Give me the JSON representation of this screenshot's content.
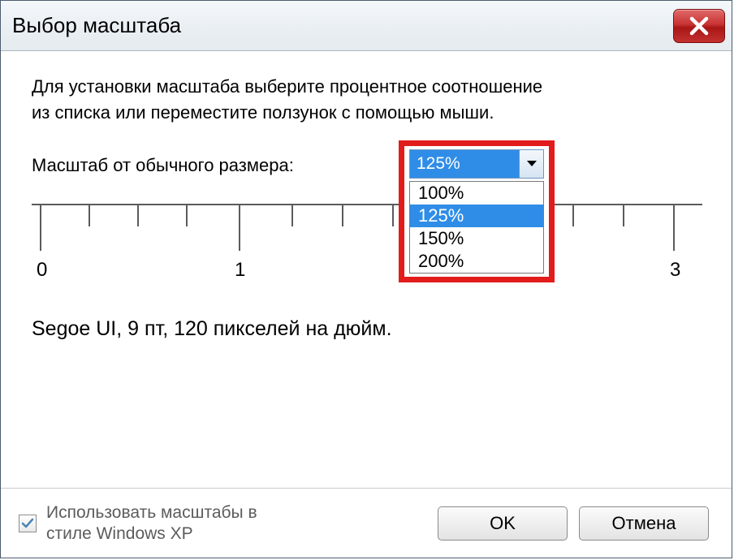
{
  "titlebar": {
    "title": "Выбор масштаба"
  },
  "description": {
    "line1": "Для установки масштаба выберите процентное соотношение",
    "line2": "из списка или переместите ползунок с помощью мыши."
  },
  "scale": {
    "label": "Масштаб от обычного размера:",
    "selected_value": "125%",
    "options": [
      "100%",
      "125%",
      "150%",
      "200%"
    ],
    "selected_index": 1
  },
  "ruler": {
    "labels": [
      "0",
      "1",
      "3"
    ]
  },
  "status_line": "Segoe UI, 9 пт, 120 пикселей на дюйм.",
  "checkbox": {
    "label_line1": "Использовать масштабы в",
    "label_line2": "стиле Windows XP",
    "checked": true
  },
  "buttons": {
    "ok": "OK",
    "cancel": "Отмена"
  },
  "colors": {
    "highlight_border": "#e21b1b",
    "selection": "#2f8de7"
  }
}
